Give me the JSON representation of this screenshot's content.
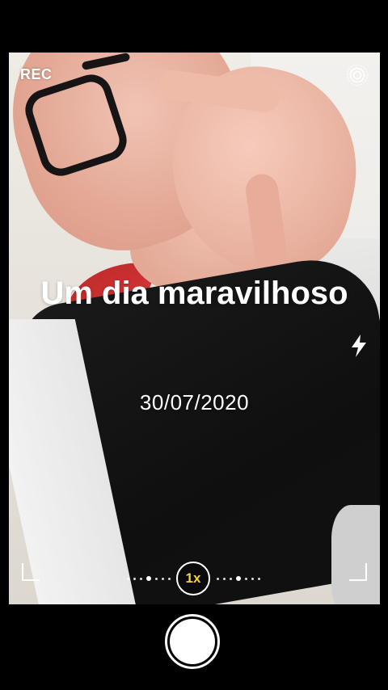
{
  "status": {
    "rec_label": "REC"
  },
  "overlay": {
    "title": "Um dia maravilhoso",
    "date": "30/07/2020"
  },
  "zoom": {
    "label": "1x",
    "color": "#f6d23a"
  },
  "icons": {
    "live": "live-photo-icon",
    "flash": "flash-icon",
    "shutter": "shutter-button"
  }
}
